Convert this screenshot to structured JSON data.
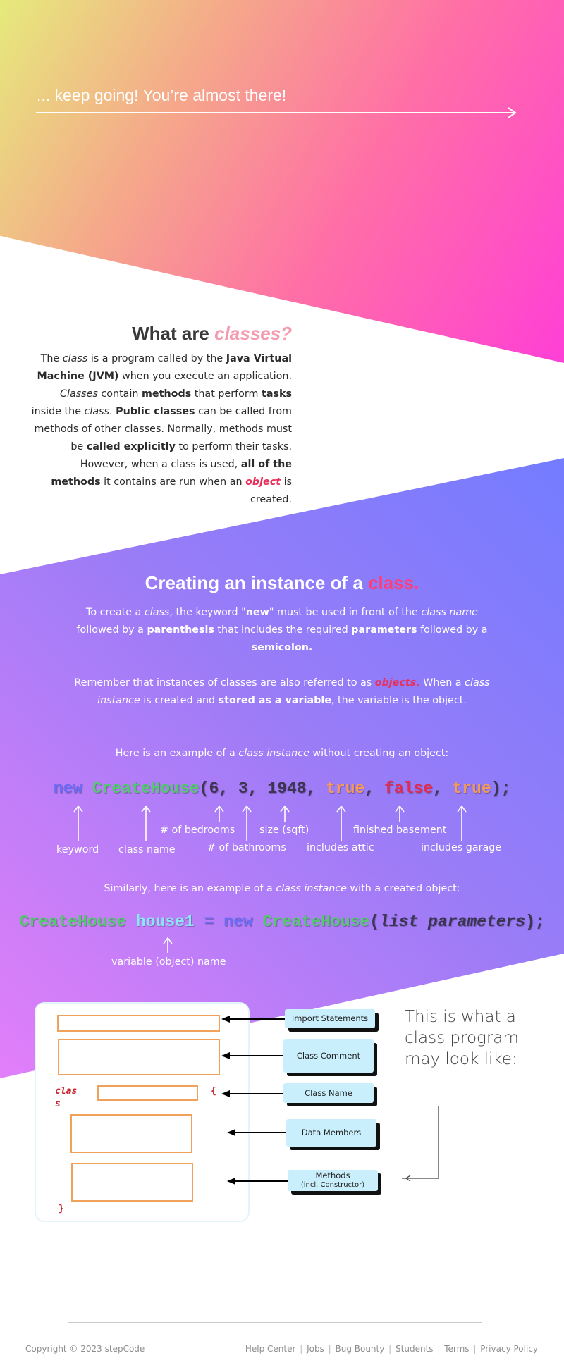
{
  "hero": {
    "text": "... keep going! You’re almost there!"
  },
  "section1": {
    "title_plain": "What are ",
    "title_accent": "classes?",
    "t1": "The ",
    "t2": "class",
    "t3": " is a program called by the ",
    "t4": "Java Virtual Machine (JVM)",
    "t5": " when you execute an application. ",
    "t6": "Classes",
    "t7": " contain ",
    "t8": "methods",
    "t9": " that perform ",
    "t10": "tasks",
    "t11": " inside the ",
    "t12": "class",
    "t13": ". ",
    "t14": "Public classes",
    "t15": " can be called from methods of other classes. Normally, methods must be ",
    "t16": "called explicitly",
    "t17": " to perform their tasks. However, when a class is used, ",
    "t18": "all of the methods",
    "t19": " it contains are run when an ",
    "t20": "object",
    "t21": " is created."
  },
  "section2": {
    "title_plain": "Creating an instance of a ",
    "title_accent": "class.",
    "p1": {
      "a": "To create a ",
      "b": "class",
      "c": ", the keyword \"",
      "d": "new",
      "e": "\" must be used in front of the ",
      "f": "class name",
      "g": " followed by a ",
      "h": "parenthesis",
      "i": " that includes the required ",
      "j": "parameters",
      "k": " followed by a ",
      "l": "semicolon."
    },
    "p2": {
      "a": "Remember that instances of classes are also referred to as ",
      "b": "objects.",
      "c": " When a ",
      "d": "class instance",
      "e": " is created and ",
      "f": "stored as a variable",
      "g": ", the variable is the object."
    },
    "p3": {
      "a": "Here is an example of a ",
      "b": "class instance",
      "c": " without creating an object:"
    },
    "code1": {
      "kw": "new",
      "cls": "CreateHouse",
      "open": "(",
      "n1": "6",
      "c1": ", ",
      "n2": "3",
      "c2": ", ",
      "n3": "1948",
      "c3": ", ",
      "b1": "true",
      "c4": ", ",
      "b2": "false",
      "c5": ", ",
      "b3": "true",
      "close": ");"
    },
    "labels": {
      "keyword": "keyword",
      "class_name": "class name",
      "bedrooms": "# of bedrooms",
      "bathrooms": "# of bathrooms",
      "size": "size (sqft)",
      "attic": "includes attic",
      "basement": "finished basement",
      "garage": "includes garage"
    },
    "p4": {
      "a": "Similarly, here is an example of a ",
      "b": "class instance",
      "c": " with a created object:"
    },
    "code2": {
      "cls": "CreateHouse",
      "sp1": " ",
      "var": "house1",
      "eq": " = ",
      "kw": "new",
      "sp2": " ",
      "cls2": "CreateHouse",
      "open": "(",
      "params": "list parameters",
      "close": ");"
    },
    "var_label": "variable (object) name"
  },
  "diagram": {
    "callouts": {
      "import": "Import Statements",
      "comment": "Class Comment",
      "name": "Class Name",
      "data": "Data Members",
      "methods": "Methods",
      "methods_sub": "(incl. Constructor)"
    },
    "keyword_class": "clas",
    "keyword_class2": "s",
    "brace_open": "{",
    "brace_close": "}",
    "side_text": "This is what a class program may look like:"
  },
  "footer": {
    "copyright": "Copyright © 2023 stepCode",
    "links": [
      "Help Center",
      "Jobs",
      "Bug Bounty",
      "Students",
      "Terms",
      "Privacy Policy"
    ]
  },
  "colors": {
    "accent_pink": "#e8305c",
    "class_green": "#55c771",
    "keyword_blue": "#6a6cf5",
    "bool_orange": "#f49a5c"
  }
}
